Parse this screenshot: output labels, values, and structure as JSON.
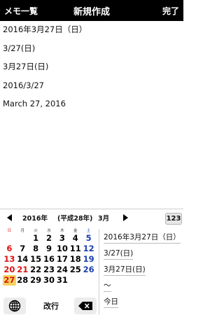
{
  "navbar": {
    "left_label": "メモ一覧",
    "title": "新規作成",
    "right_label": "完了"
  },
  "document": {
    "lines": [
      "2016年3月27日（日）",
      "3/27(日)",
      "3月27日(日)",
      "2016/3/27",
      "March 27, 2016"
    ]
  },
  "keyboard": {
    "calendar": {
      "year": "2016年",
      "era": "(平成28年)",
      "month": "3月",
      "numeric_key": "123",
      "weekdays": [
        "日",
        "月",
        "火",
        "水",
        "木",
        "金",
        "土"
      ],
      "weeks": [
        [
          "",
          "",
          "1",
          "2",
          "3",
          "4",
          "5"
        ],
        [
          "6",
          "7",
          "8",
          "9",
          "10",
          "11",
          "12"
        ],
        [
          "13",
          "14",
          "15",
          "16",
          "17",
          "18",
          "19"
        ],
        [
          "20",
          "21",
          "22",
          "23",
          "24",
          "25",
          "26"
        ],
        [
          "27",
          "28",
          "29",
          "30",
          "31",
          "",
          ""
        ]
      ],
      "today": "27",
      "holiday_color": "#dd1111",
      "saturday_color": "#1a3fb0",
      "highlight_color": "#f5d35c"
    },
    "suggestions": [
      "2016年3月27日（日）",
      "3/27(日)",
      "3月27日(日)",
      "〜",
      "今日"
    ],
    "enter_label": "改行",
    "globe_icon": "globe-icon",
    "delete_icon": "backspace-icon"
  }
}
